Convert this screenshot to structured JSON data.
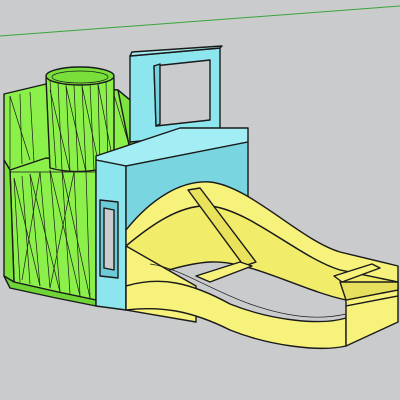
{
  "app": {
    "type": "3d-modeling-viewport",
    "background_color": "#c9cbcc"
  },
  "scene": {
    "model_parts": [
      {
        "name": "cylinder-holder",
        "color": "#8cf04a",
        "shade_color": "#6fd436",
        "face_style": "triangulated"
      },
      {
        "name": "center-block",
        "color": "#8de6ee",
        "shade_color": "#72cfd9"
      },
      {
        "name": "handle-frame",
        "color": "#8de6ee"
      },
      {
        "name": "curved-tray",
        "color": "#f6f27b",
        "shade_color": "#e6e05e"
      }
    ],
    "axes": [
      {
        "name": "green-axis",
        "color": "#3aa53a"
      }
    ],
    "edge_color": "#1a1a1a"
  }
}
